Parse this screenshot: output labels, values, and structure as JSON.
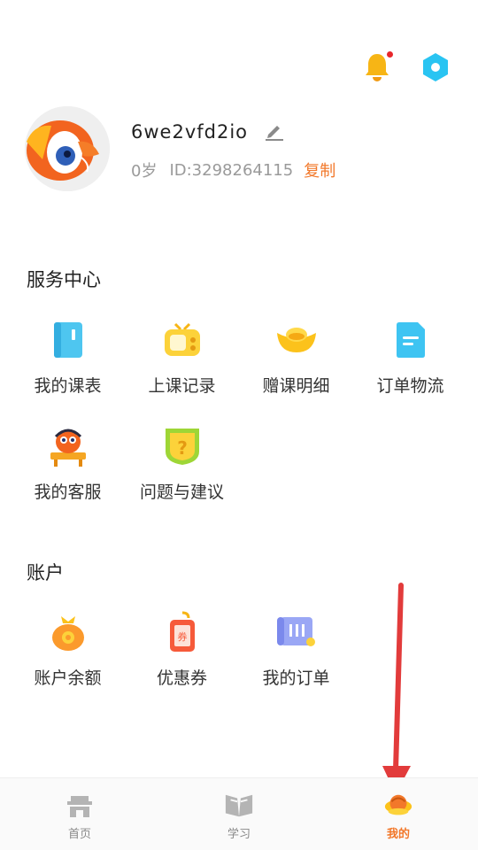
{
  "header": {
    "bell_icon": "bell-icon",
    "settings_icon": "settings-icon"
  },
  "profile": {
    "username": "6we2vfd2io",
    "age": "0岁",
    "id_text": "ID:3298264115",
    "copy_label": "复制"
  },
  "service_center": {
    "title": "服务中心",
    "items": [
      {
        "label": "我的课表",
        "icon": "schedule-book-icon"
      },
      {
        "label": "上课记录",
        "icon": "tv-record-icon"
      },
      {
        "label": "赠课明细",
        "icon": "gold-ingot-icon"
      },
      {
        "label": "订单物流",
        "icon": "document-icon"
      },
      {
        "label": "我的客服",
        "icon": "customer-service-icon"
      },
      {
        "label": "问题与建议",
        "icon": "question-shield-icon"
      }
    ]
  },
  "account": {
    "title": "账户",
    "items": [
      {
        "label": "账户余额",
        "icon": "money-bag-icon"
      },
      {
        "label": "优惠券",
        "icon": "coupon-icon"
      },
      {
        "label": "我的订单",
        "icon": "order-scroll-icon"
      }
    ]
  },
  "tabbar": {
    "tabs": [
      {
        "label": "首页",
        "active": false
      },
      {
        "label": "学习",
        "active": false
      },
      {
        "label": "我的",
        "active": true
      }
    ]
  },
  "colors": {
    "accent": "#f2782a",
    "annotation_arrow": "#e23b3b"
  }
}
